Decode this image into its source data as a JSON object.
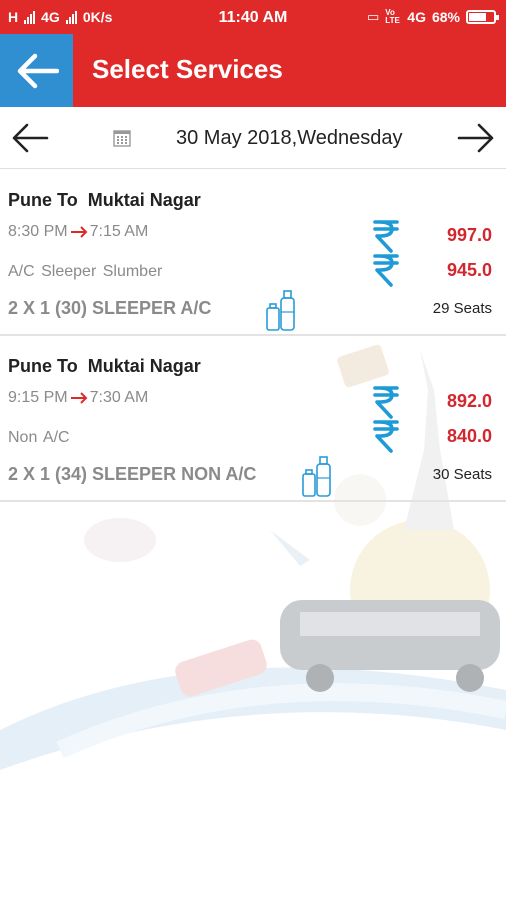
{
  "status_bar": {
    "left_label": "H",
    "network": "4G",
    "speed": "0K/s",
    "time": "11:40 AM",
    "volte": "Vo LTE",
    "network2": "4G",
    "battery": "68%"
  },
  "app_bar": {
    "title": "Select Services"
  },
  "date_nav": {
    "date": "30 May 2018,Wednesday"
  },
  "services": [
    {
      "from": "Pune",
      "to_word": "To",
      "to": "Muktai Nagar",
      "depart": "8:30 PM",
      "arrive": "7:15 AM",
      "amenities": "A/C   Sleeper  Slumber",
      "bus_type": "2 X 1 (30) SLEEPER A/C",
      "fare1": "997.0",
      "fare2": "945.0",
      "seats": "29 Seats"
    },
    {
      "from": "Pune",
      "to_word": "To",
      "to": "Muktai Nagar",
      "depart": "9:15 PM",
      "arrive": "7:30 AM",
      "amenities": "Non A/C",
      "bus_type": "2 X 1 (34) SLEEPER NON A/C",
      "fare1": "892.0",
      "fare2": "840.0",
      "seats": "30 Seats"
    }
  ],
  "icons": {
    "back": "arrow-left-icon",
    "prev_date": "arrow-left-icon",
    "next_date": "arrow-right-icon",
    "calendar": "calendar-icon",
    "rupee": "rupee-icon",
    "water": "water-bottle-icon"
  },
  "colors": {
    "primary_red": "#e02a2a",
    "back_blue": "#2f8fd0",
    "price_red": "#d3262f",
    "rupee_blue": "#1e9bd7"
  }
}
